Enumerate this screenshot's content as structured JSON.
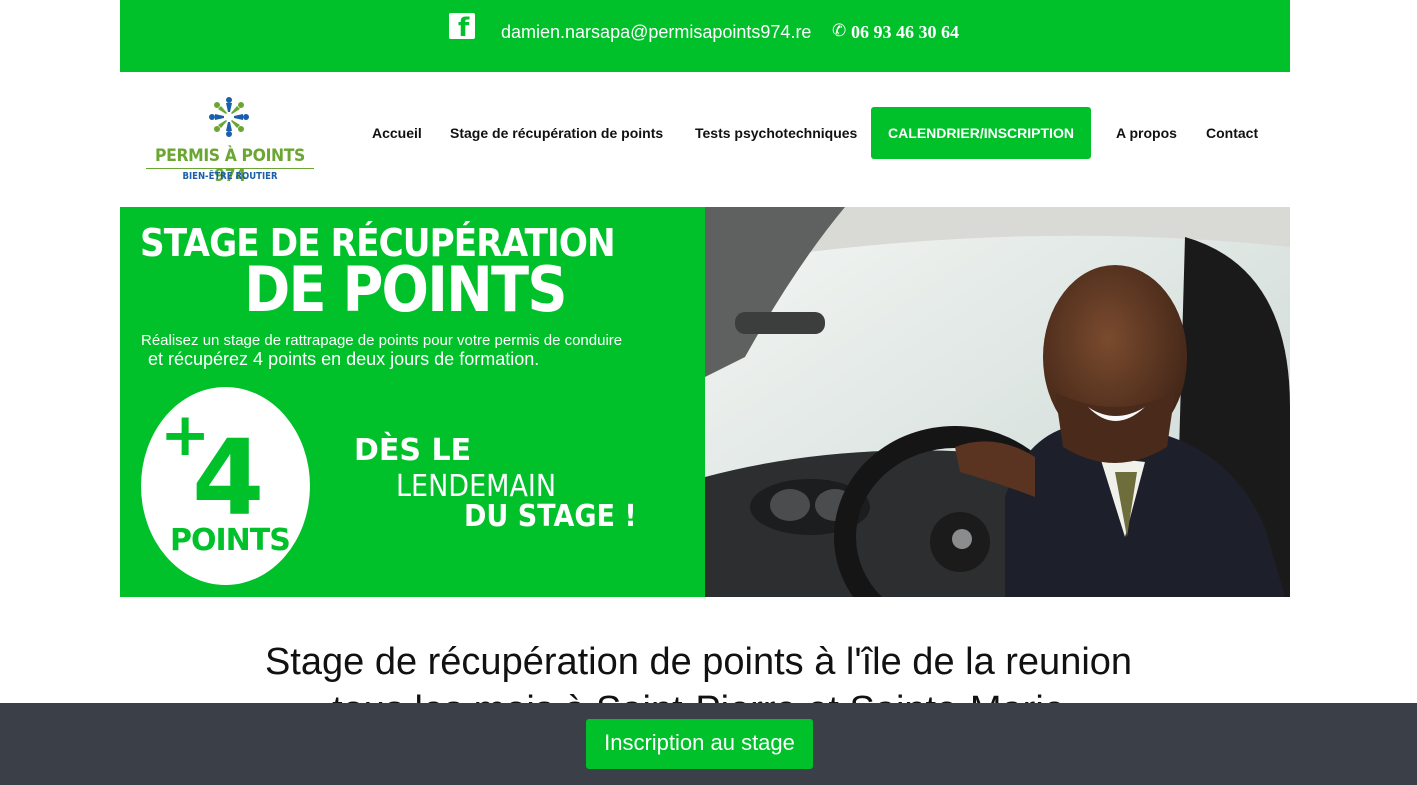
{
  "topbar": {
    "facebook_icon": "facebook-icon",
    "email": "damien.narsapa@permisapoints974.re",
    "phone_icon": "phone-icon",
    "phone": "06 93 46 30 64"
  },
  "logo": {
    "title": "PERMIS À POINTS 974",
    "subtitle": "BIEN-ÊTRE ROUTIER"
  },
  "nav": {
    "items": [
      {
        "label": "Accueil"
      },
      {
        "label": "Stage de récupération de points"
      },
      {
        "label": "Tests psychotechniques"
      },
      {
        "label": "CALENDRIER/INSCRIPTION"
      },
      {
        "label": "A propos"
      },
      {
        "label": "Contact"
      }
    ]
  },
  "hero": {
    "line1": "STAGE DE RÉCUPÉRATION",
    "line2": "DE POINTS",
    "text1": "Réalisez un stage de rattrapage de points pour votre permis de conduire",
    "text2": "et récupérez 4 points en deux jours de formation.",
    "badge_plus": "+",
    "badge_number": "4",
    "badge_label": "POINTS",
    "des1": "DÈS LE",
    "des2": "LENDEMAIN",
    "des3": "DU STAGE !"
  },
  "main": {
    "title_line1": "Stage de récupération de points à l'île de la reunion",
    "title_line2": "tous les mois à Saint-Pierre et Sainte-Marie"
  },
  "bottombar": {
    "button_label": "Inscription au stage"
  },
  "colors": {
    "brand_green": "#00c12a",
    "bottom_bar": "#3b3f48"
  }
}
